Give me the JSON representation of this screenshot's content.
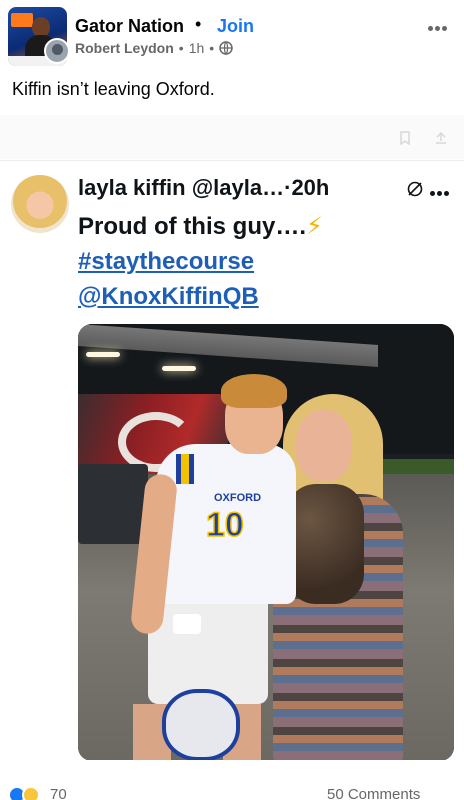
{
  "post": {
    "group_name": "Gator Nation",
    "separator": "•",
    "join_label": "Join",
    "author": "Robert Leydon",
    "meta_sep_1": "•",
    "time": "1h",
    "meta_sep_2": "•",
    "privacy_icon": "globe-icon",
    "more_icon": "more-horizontal-icon",
    "text": "Kiffin isn’t leaving Oxford."
  },
  "tweet": {
    "display_name": "layla kiffin",
    "handle": "@layla…",
    "time_sep": "·",
    "time": "20h",
    "mute_icon": "mute-icon",
    "more_icon": "more-horizontal-icon",
    "body_text": "Proud of this guy….",
    "emoji": "⚡",
    "hashtag": "#staythecourse",
    "mention": "@KnoxKiffinQB",
    "photo": {
      "jersey_school": "OXFORD",
      "jersey_number": "10"
    }
  },
  "stats": {
    "reactions_count": "70",
    "comments_label": "50 Comments"
  },
  "colors": {
    "link": "#1877f2",
    "tweet_link": "#1d5fb8",
    "meta_text": "#65676b"
  }
}
